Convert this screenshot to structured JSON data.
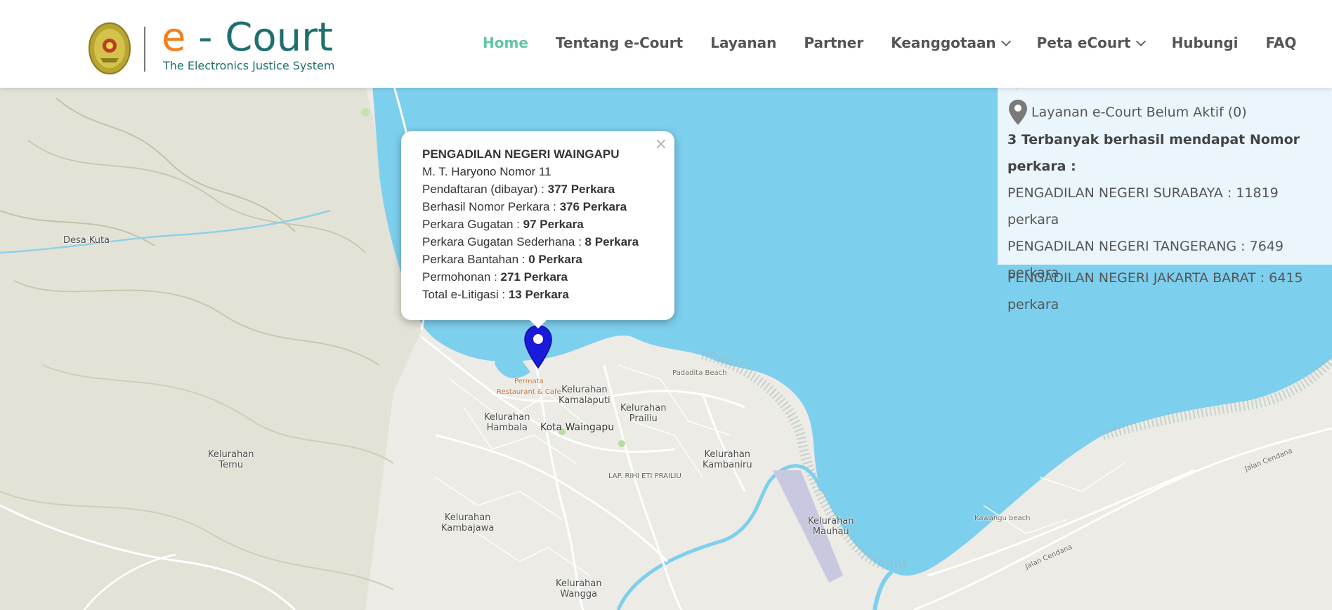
{
  "header": {
    "logo_e": "e",
    "logo_rest": " - Court",
    "tagline": "The Electronics Justice System",
    "nav": [
      {
        "label": "Home",
        "active": true,
        "dropdown": false
      },
      {
        "label": "Tentang e-Court",
        "active": false,
        "dropdown": false
      },
      {
        "label": "Layanan",
        "active": false,
        "dropdown": false
      },
      {
        "label": "Partner",
        "active": false,
        "dropdown": false
      },
      {
        "label": "Keanggotaan",
        "active": false,
        "dropdown": true
      },
      {
        "label": "Peta eCourt",
        "active": false,
        "dropdown": true
      },
      {
        "label": "Hubungi",
        "active": false,
        "dropdown": false
      },
      {
        "label": "FAQ",
        "active": false,
        "dropdown": false
      }
    ]
  },
  "legend": {
    "inactive_label": "Layanan e-Court Belum Aktif (0)",
    "top_heading": "3 Terbanyak berhasil mendapat Nomor perkara :",
    "top": [
      "PENGADILAN NEGERI SURABAYA : 11819 perkara",
      "PENGADILAN NEGERI TANGERANG : 7649 perkara",
      "PENGADILAN NEGERI JAKARTA BARAT : 6415 perkara"
    ],
    "active_color": "#2eaa2e",
    "inactive_color": "#7a7a7a"
  },
  "popup": {
    "close": "×",
    "title": "PENGADILAN NEGERI WAINGAPU",
    "address": "M. T. Haryono Nomor 11",
    "stats": [
      {
        "label": "Pendaftaran (dibayar) : ",
        "value": "377 Perkara"
      },
      {
        "label": "Berhasil Nomor Perkara : ",
        "value": "376 Perkara"
      },
      {
        "label": "Perkara Gugatan : ",
        "value": "97 Perkara"
      },
      {
        "label": "Perkara Gugatan Sederhana : ",
        "value": "8 Perkara"
      },
      {
        "label": "Perkara Bantahan : ",
        "value": "0 Perkara"
      },
      {
        "label": "Permohonan : ",
        "value": "271 Perkara"
      },
      {
        "label": "Total e-Litigasi : ",
        "value": "13 Perkara"
      }
    ]
  },
  "map": {
    "labels": {
      "desa_kuta": "Desa Kuta",
      "kel_temu": "Kelurahan\nTemu",
      "kel_kamalaputi": "Kelurahan\nKamalaputi",
      "kel_prailiu": "Kelurahan\nPrailiu",
      "kel_hambala": "Kelurahan\nHambala",
      "kota_waingapu": "Kota Waingapu",
      "kel_kambaniru": "Kelurahan\nKambaniru",
      "lap_rihi": "LAP. RIHI ETI PRAILIU",
      "kel_kambajawa": "Kelurahan\nKambajawa",
      "kel_mauhau": "Kelurahan\nMauhau",
      "kel_wangga": "Kelurahan\nWangga",
      "padadita": "Padadita Beach",
      "permata": "Permata\nRestaurant & Cafe",
      "kawangu": "Kawangu beach",
      "jalan_cendana_1": "Jalan Cendana",
      "jalan_cendana_2": "Jalan Cendana"
    },
    "water_color": "#7dcfee",
    "land_color": "#ecebe5",
    "marker_color": "#1a1adb"
  }
}
